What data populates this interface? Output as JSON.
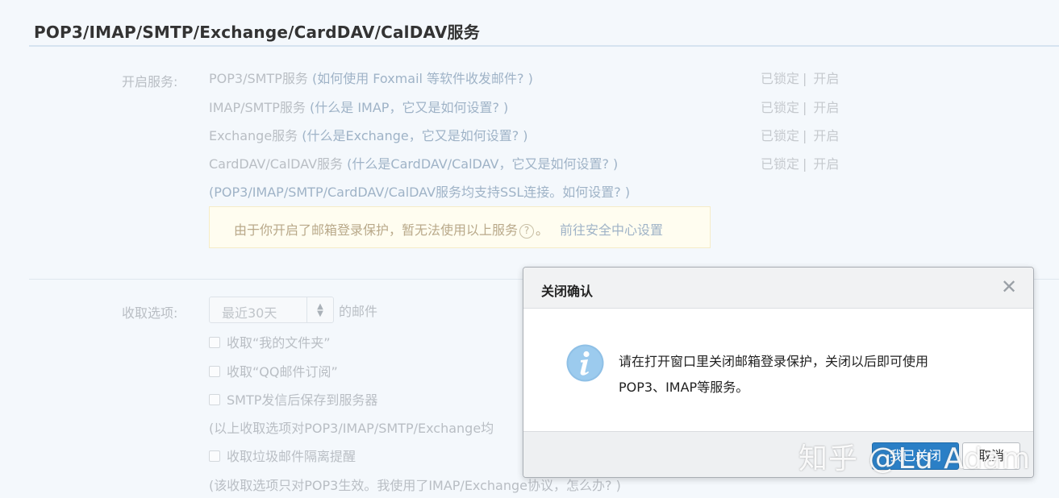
{
  "section": {
    "title": "POP3/IMAP/SMTP/Exchange/CardDAV/CalDAV服务"
  },
  "services": {
    "label": "开启服务:",
    "rows": [
      {
        "name": "POP3/SMTP服务",
        "help": "(如何使用 Foxmail 等软件收发邮件? )",
        "locked": "已锁定",
        "sep": "|",
        "action": "开启"
      },
      {
        "name": "IMAP/SMTP服务",
        "help": "(什么是 IMAP，它又是如何设置? )",
        "locked": "已锁定",
        "sep": "|",
        "action": "开启"
      },
      {
        "name": "Exchange服务",
        "help": "(什么是Exchange，它又是如何设置? )",
        "locked": "已锁定",
        "sep": "|",
        "action": "开启"
      },
      {
        "name": "CardDAV/CalDAV服务",
        "help": "(什么是CardDAV/CalDAV，它又是如何设置? )",
        "locked": "已锁定",
        "sep": "|",
        "action": "开启"
      }
    ],
    "ssl_note": "(POP3/IMAP/SMTP/CardDAV/CalDAV服务均支持SSL连接。如何设置? )"
  },
  "notice": {
    "text": "由于你开启了邮箱登录保护，暂无法使用以上服务",
    "help_icon": "?",
    "end": "。",
    "link": "前往安全中心设置"
  },
  "receive": {
    "label": "收取选项:",
    "select_value": "最近30天",
    "select_arrows": "▲▼",
    "select_suffix": "的邮件",
    "options": [
      "收取“我的文件夹”",
      "收取“QQ邮件订阅”",
      "SMTP发信后保存到服务器"
    ],
    "note1": "(以上收取选项对POP3/IMAP/SMTP/Exchange均",
    "spam_option": "收取垃圾邮件隔离提醒",
    "note2": "(该收取选项只对POP3生效。我使用了IMAP/Exchange协议，怎么办? )"
  },
  "dialog": {
    "title": "关闭确认",
    "close_glyph": "✕",
    "message_line1": "请在打开窗口里关闭邮箱登录保护，关闭以后即可使用",
    "message_line2": "POP3、IMAP等服务。",
    "confirm_label": "我已关闭",
    "cancel_label": "取消",
    "icon": "info-icon"
  },
  "watermark": "知乎 @Lu Adam",
  "colors": {
    "accent": "#2a7fc6",
    "info_icon": "#8fc0e6",
    "page_bg": "#f4f8fc"
  }
}
